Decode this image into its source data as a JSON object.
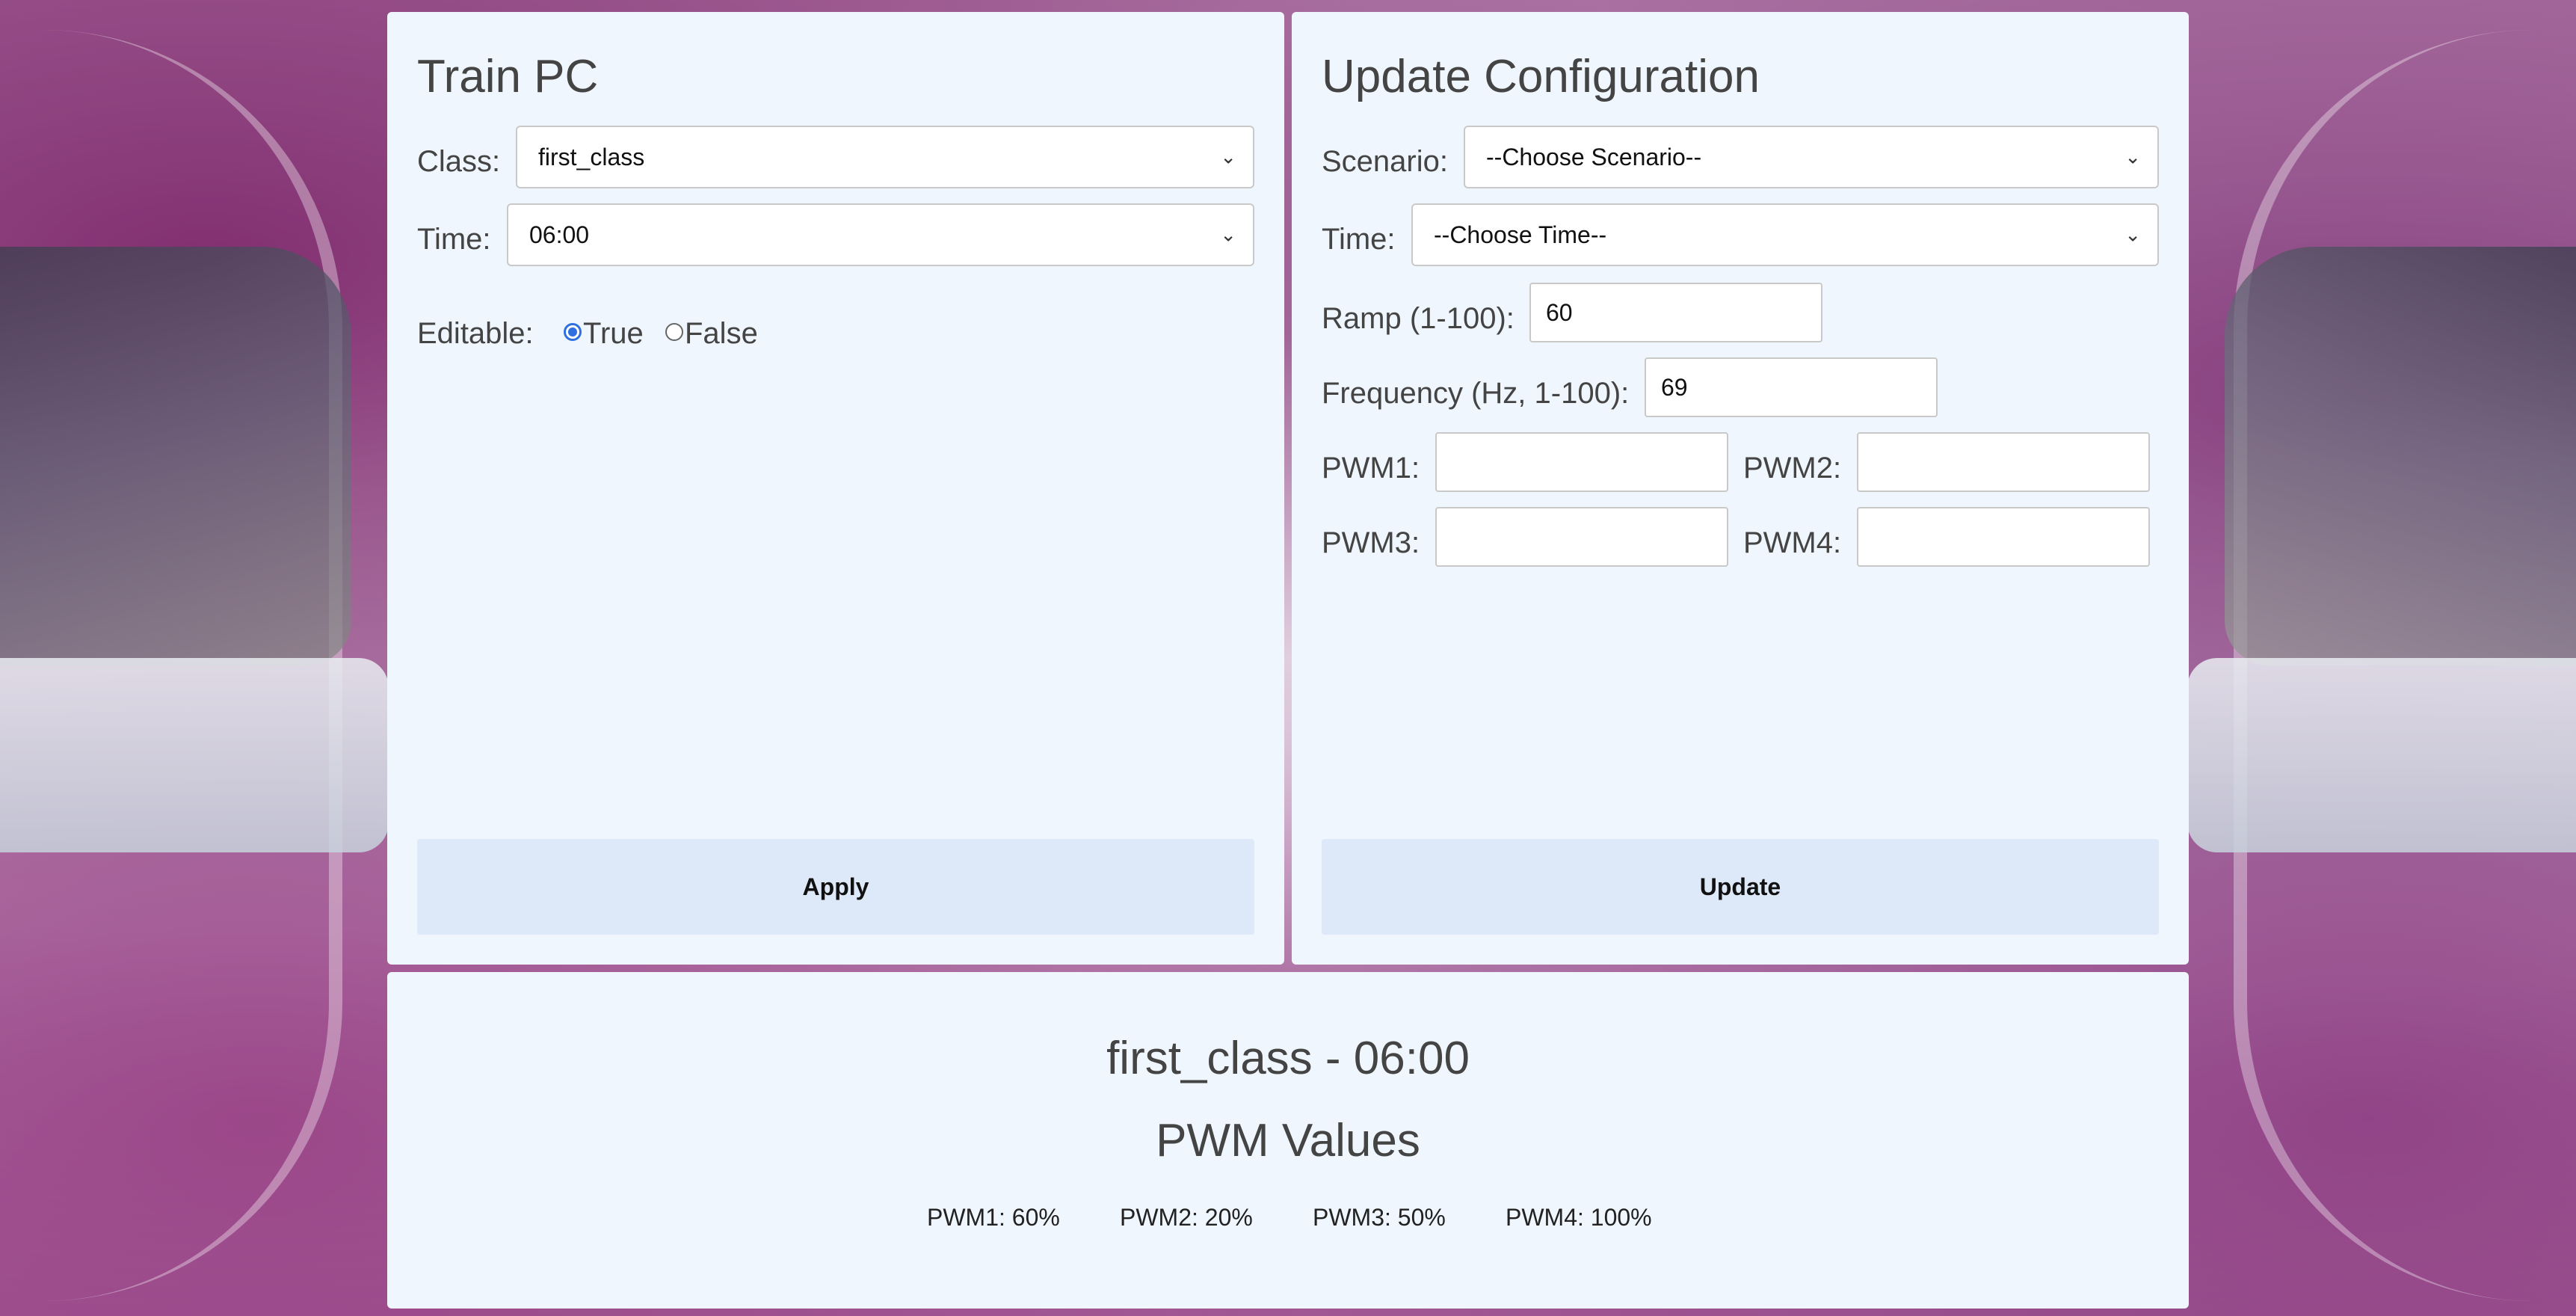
{
  "colors": {
    "panel_bg": "#eff6fd",
    "button_bg": "#dde8f8",
    "radio_accent": "#2f6fe0",
    "text": "#444444"
  },
  "train_pc": {
    "title": "Train PC",
    "class_label": "Class:",
    "class_value": "first_class",
    "time_label": "Time:",
    "time_value": "06:00",
    "editable_label": "Editable:",
    "editable_true_label": "True",
    "editable_false_label": "False",
    "editable_selected": "True",
    "apply_label": "Apply"
  },
  "update_config": {
    "title": "Update Configuration",
    "scenario_label": "Scenario:",
    "scenario_value": "--Choose Scenario--",
    "time_label": "Time:",
    "time_value": "--Choose Time--",
    "ramp_label": "Ramp (1-100):",
    "ramp_value": "60",
    "frequency_label": "Frequency (Hz, 1-100):",
    "frequency_value": "69",
    "pwm1_label": "PWM1:",
    "pwm1_value": "",
    "pwm2_label": "PWM2:",
    "pwm2_value": "",
    "pwm3_label": "PWM3:",
    "pwm3_value": "",
    "pwm4_label": "PWM4:",
    "pwm4_value": "",
    "update_label": "Update"
  },
  "summary": {
    "heading": "first_class - 06:00",
    "subheading": "PWM Values",
    "values": [
      "PWM1: 60%",
      "PWM2: 20%",
      "PWM3: 50%",
      "PWM4: 100%"
    ]
  },
  "icons": {
    "select_chevron": "chevron-down-icon"
  }
}
